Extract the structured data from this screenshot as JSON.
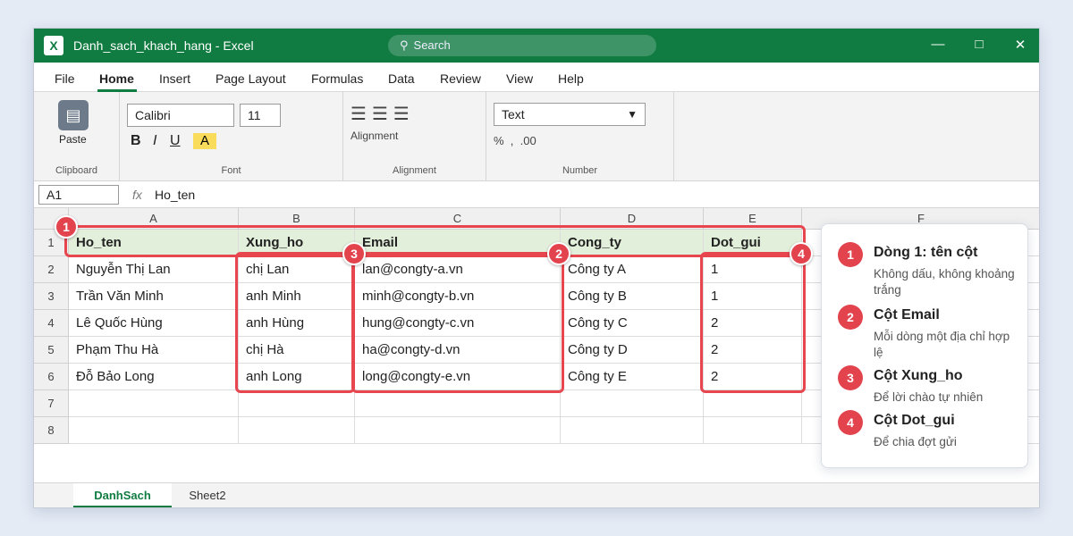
{
  "window": {
    "title": "Danh_sach_khach_hang - Excel",
    "app_icon": "X",
    "search_placeholder": "Search"
  },
  "window_controls": {
    "minimize": "—",
    "maximize": "□",
    "close": "✕"
  },
  "menu": [
    "File",
    "Home",
    "Insert",
    "Page Layout",
    "Formulas",
    "Data",
    "Review",
    "View",
    "Help"
  ],
  "menu_active": "Home",
  "ribbon": {
    "clipboard": {
      "paste_label": "Paste",
      "group_label": "Clipboard"
    },
    "font": {
      "family": "Calibri",
      "size": "11",
      "bold": "B",
      "italic": "I",
      "underline": "U",
      "highlight": "A",
      "group_label": "Font"
    },
    "alignment": {
      "label": "Alignment",
      "group_label": "Alignment"
    },
    "number": {
      "format": "Text",
      "percent": "%",
      "comma": ",",
      "decimal": ".00",
      "group_label": "Number"
    }
  },
  "formula_bar": {
    "name_box": "A1",
    "fx": "fx",
    "value": "Ho_ten"
  },
  "columns": [
    "A",
    "B",
    "C",
    "D",
    "E",
    "F"
  ],
  "rows": [
    "1",
    "2",
    "3",
    "4",
    "5",
    "6",
    "7",
    "8"
  ],
  "table": {
    "header": [
      "Ho_ten",
      "Xung_ho",
      "Email",
      "Cong_ty",
      "Dot_gui"
    ],
    "data": [
      [
        "Nguyễn Thị Lan",
        "chị Lan",
        "lan@congty-a.vn",
        "Công ty A",
        "1"
      ],
      [
        "Trần Văn Minh",
        "anh Minh",
        "minh@congty-b.vn",
        "Công ty B",
        "1"
      ],
      [
        "Lê Quốc Hùng",
        "anh Hùng",
        "hung@congty-c.vn",
        "Công ty C",
        "2"
      ],
      [
        "Phạm Thu Hà",
        "chị Hà",
        "ha@congty-d.vn",
        "Công ty D",
        "2"
      ],
      [
        "Đỗ Bảo Long",
        "anh Long",
        "long@congty-e.vn",
        "Công ty E",
        "2"
      ]
    ]
  },
  "annotations": {
    "badges": [
      "1",
      "2",
      "3",
      "4"
    ],
    "legend": [
      {
        "num": "1",
        "title": "Dòng 1: tên cột",
        "desc": "Không dấu, không khoảng trắng"
      },
      {
        "num": "2",
        "title": "Cột Email",
        "desc": "Mỗi dòng một địa chỉ hợp lệ"
      },
      {
        "num": "3",
        "title": "Cột Xung_ho",
        "desc": "Để lời chào tự nhiên"
      },
      {
        "num": "4",
        "title": "Cột Dot_gui",
        "desc": "Để chia đợt gửi"
      }
    ]
  },
  "sheets": [
    "DanhSach",
    "Sheet2"
  ],
  "colors": {
    "excel_green": "#117c41",
    "header_fill": "#e2efda",
    "highlight_red": "#e8464f",
    "badge_red": "#e3434d"
  }
}
